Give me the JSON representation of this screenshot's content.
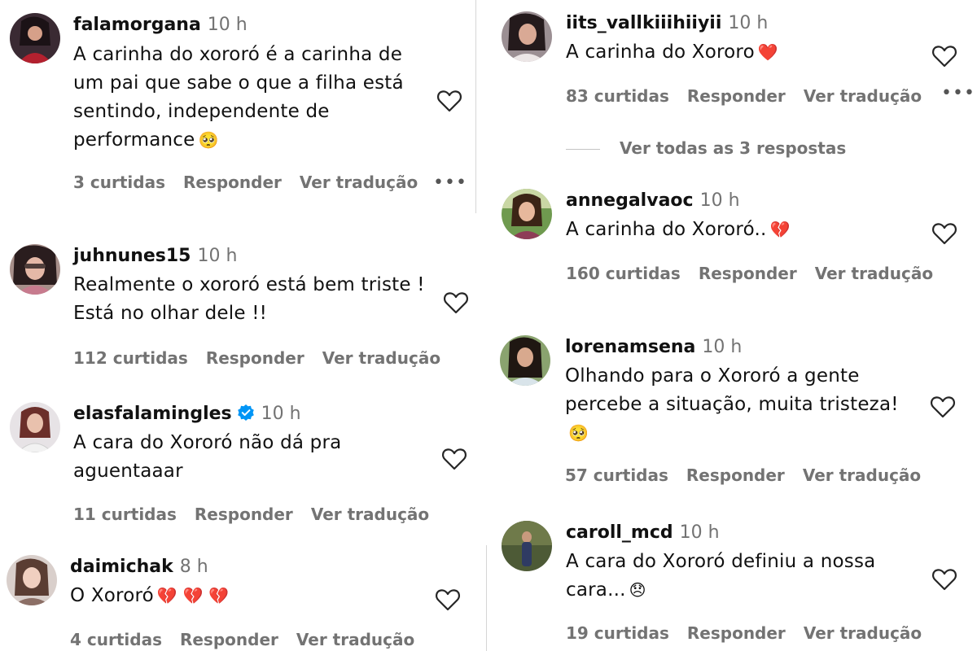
{
  "actions": {
    "reply": "Responder",
    "translate": "Ver tradução"
  },
  "comments": [
    {
      "username": "falamorgana",
      "time": "10 h",
      "text": "A carinha do xororó é a carinha de um pai que sabe o que a filha está sentindo, independente de performance",
      "emoji": "🥺",
      "likes": "3 curtidas"
    },
    {
      "username": "juhnunes15",
      "time": "10 h",
      "text": "Realmente o xororó está bem triste ! Está no olhar dele !!",
      "likes": "112 curtidas"
    },
    {
      "username": "elasfalamingles",
      "time": "10 h",
      "text": "A cara do Xororó não dá pra aguentaaar",
      "likes": "11 curtidas"
    },
    {
      "username": "daimichak",
      "time": "8 h",
      "text": "O Xororó",
      "emoji": "💔 💔 💔",
      "likes": "4 curtidas"
    },
    {
      "username": "iits_vallkiiihiiyii",
      "time": "10 h",
      "text": "A carinha do Xororo",
      "emoji": "❤️",
      "likes": "83 curtidas",
      "replies": "Ver todas as 3 respostas"
    },
    {
      "username": "annegalvaoc",
      "time": "10 h",
      "text": "A carinha do Xororó..",
      "emoji": "💔",
      "likes": "160 curtidas"
    },
    {
      "username": "lorenamsena",
      "time": "10 h",
      "text": "Olhando para o Xororó a gente percebe a situação, muita tristeza!",
      "emoji": "🥺",
      "likes": "57 curtidas"
    },
    {
      "username": "caroll_mcd",
      "time": "10 h",
      "text": "A cara do Xororó definiu a nossa cara...",
      "emoji": "😞",
      "likes": "19 curtidas"
    }
  ],
  "colors": {
    "text": "#111111",
    "muted": "#737373",
    "verified": "#0095f6",
    "heart_red": "#e0245e"
  },
  "icons": {
    "like": "heart-outline-icon",
    "more": "more-options-icon",
    "verified": "verified-badge-icon"
  }
}
